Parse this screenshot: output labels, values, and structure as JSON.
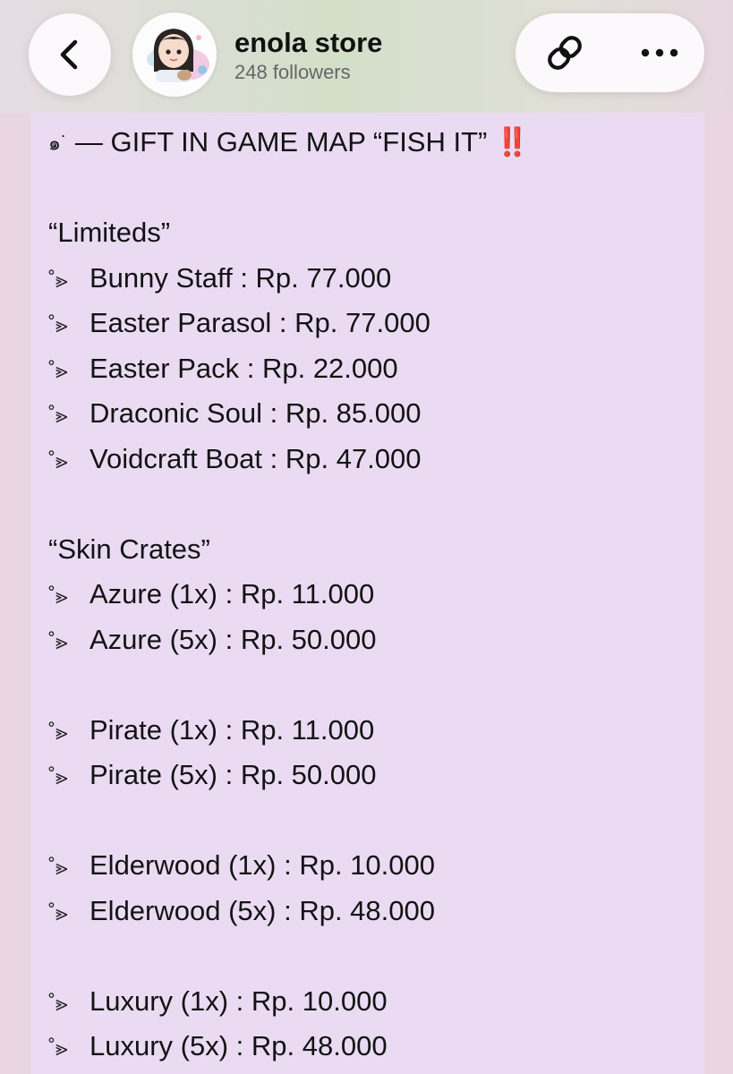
{
  "header": {
    "channel_name": "enola store",
    "followers": "248 followers"
  },
  "post": {
    "title_prefix": "๑˙",
    "title": "— GIFT IN GAME MAP “FISH IT” ‼️",
    "bullet": "˚⪢",
    "sections": [
      {
        "heading": "“Limiteds”",
        "items": [
          "Bunny Staff : Rp. 77.000",
          "Easter Parasol : Rp. 77.000",
          "Easter Pack : Rp. 22.000",
          "Draconic Soul : Rp. 85.000",
          "Voidcraft Boat : Rp. 47.000"
        ]
      },
      {
        "heading": "“Skin Crates”",
        "items": [
          "Azure (1x) : Rp. 11.000",
          "Azure (5x) : Rp. 50.000",
          "Pirate (1x) : Rp. 11.000",
          "Pirate (5x) : Rp. 50.000",
          "Elderwood (1x) : Rp. 10.000",
          "Elderwood (5x) : Rp. 48.000",
          "Luxury (1x) : Rp. 10.000",
          "Luxury (5x) : Rp. 48.000"
        ]
      }
    ]
  }
}
